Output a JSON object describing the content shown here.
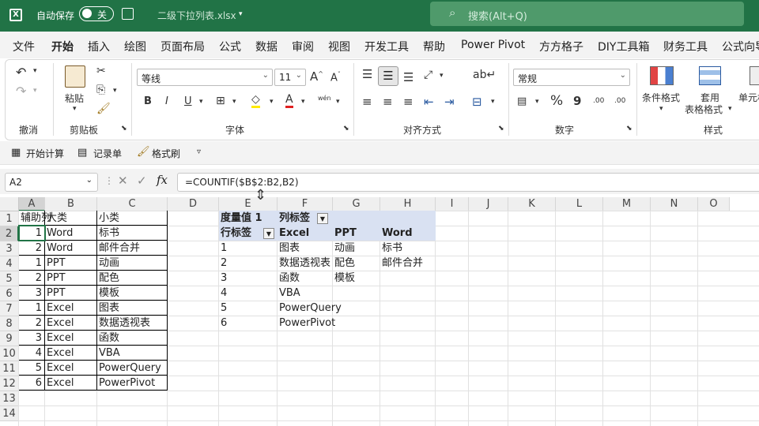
{
  "titlebar": {
    "autosave": "自动保存",
    "toggle": "关",
    "filename": "二级下拉列表.xlsx",
    "search": "搜索(Alt+Q)"
  },
  "menu": [
    "文件",
    "开始",
    "插入",
    "绘图",
    "页面布局",
    "公式",
    "数据",
    "审阅",
    "视图",
    "开发工具",
    "帮助",
    "Power Pivot",
    "方方格子",
    "DIY工具箱",
    "财务工具",
    "公式向导"
  ],
  "ribbon": {
    "paste": "粘贴",
    "font_name": "等线",
    "font_size": "11",
    "number_format": "常规",
    "cond_format": "条件格式",
    "table_format_1": "套用",
    "table_format_2": "表格格式",
    "cell_style": "单元格",
    "bold": "B",
    "italic": "I",
    "underline": "U",
    "font_color": "A",
    "wen": "wén",
    "percent": "%",
    "comma": "9",
    "dec_inc": ".00",
    "dec_dec": ".00",
    "groups": {
      "undo": "撤消",
      "clipboard": "剪贴板",
      "font": "字体",
      "align": "对齐方式",
      "number": "数字",
      "styles": "样式"
    }
  },
  "qat": {
    "calc": "开始计算",
    "record": "记录单",
    "painter": "格式刷"
  },
  "formula_bar": {
    "name_box": "A2",
    "formula": "=COUNTIF($B$2:B2,B2)",
    "fx": "fx"
  },
  "columns": [
    "A",
    "B",
    "C",
    "D",
    "E",
    "F",
    "G",
    "H",
    "I",
    "J",
    "K",
    "L",
    "M",
    "N",
    "O"
  ],
  "rows": [
    "1",
    "2",
    "3",
    "4",
    "5",
    "6",
    "7",
    "8",
    "9",
    "10",
    "11",
    "12",
    "13",
    "14"
  ],
  "table": {
    "headers": [
      "辅助列",
      "大类",
      "小类"
    ],
    "rows": [
      [
        "1",
        "Word",
        "标书"
      ],
      [
        "2",
        "Word",
        "邮件合并"
      ],
      [
        "1",
        "PPT",
        "动画"
      ],
      [
        "2",
        "PPT",
        "配色"
      ],
      [
        "3",
        "PPT",
        "模板"
      ],
      [
        "1",
        "Excel",
        "图表"
      ],
      [
        "2",
        "Excel",
        "数据透视表"
      ],
      [
        "3",
        "Excel",
        "函数"
      ],
      [
        "4",
        "Excel",
        "VBA"
      ],
      [
        "5",
        "Excel",
        "PowerQuery"
      ],
      [
        "6",
        "Excel",
        "PowerPivot"
      ]
    ]
  },
  "pivot": {
    "measure": "度量值 1",
    "col_label": "列标签",
    "row_label": "行标签",
    "cols": [
      "Excel",
      "PPT",
      "Word"
    ],
    "rows": [
      [
        "1",
        "图表",
        "动画",
        "标书"
      ],
      [
        "2",
        "数据透视表",
        "配色",
        "邮件合并"
      ],
      [
        "3",
        "函数",
        "模板",
        ""
      ],
      [
        "4",
        "VBA",
        "",
        ""
      ],
      [
        "5",
        "PowerQuery",
        "",
        ""
      ],
      [
        "6",
        "PowerPivot",
        "",
        ""
      ]
    ]
  }
}
